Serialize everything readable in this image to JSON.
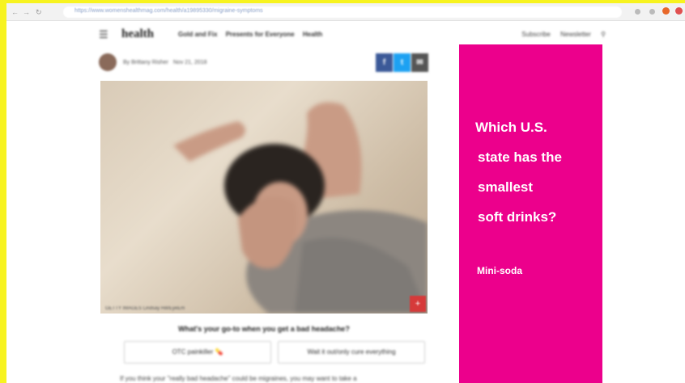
{
  "browser": {
    "url": "https://www.womenshealthmag.com/health/a19895330/migraine-symptoms",
    "back_icon": "arrow-left-icon",
    "forward_icon": "arrow-right-icon",
    "reload_icon": "reload-icon"
  },
  "site": {
    "logo": "health",
    "nav": [
      "Gold and Fix",
      "Presents for Everyone",
      "Health"
    ],
    "right_links": [
      "Subscribe",
      "Newsletter"
    ]
  },
  "article": {
    "author": "By Brittany Risher",
    "date": "Nov 21, 2018",
    "share": [
      "f",
      "t",
      "✉"
    ],
    "share_colors": [
      "#3b5998",
      "#1da1f2",
      "#555555"
    ],
    "photo_credit": "GETTY IMAGES  Lindsay Hill/EyeEm",
    "poll_question": "What's your go-to when you get a bad headache?",
    "poll_options": [
      "OTC painkiller 💊",
      "Wait it out/only cure everything"
    ],
    "body_text": "If you think your \"really bad headache\" could be migraines, you may want to take a"
  },
  "ad": {
    "question_lines": [
      "Which U.S.",
      "state has the",
      "smallest",
      "soft drinks?"
    ],
    "answer": "Mini-soda",
    "background": "#ec008c"
  }
}
